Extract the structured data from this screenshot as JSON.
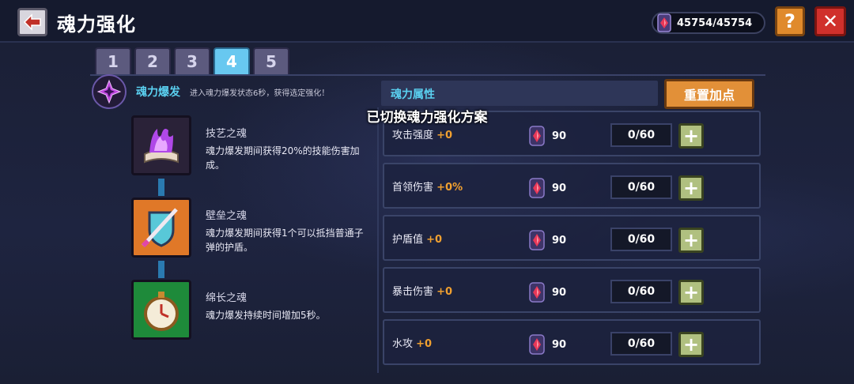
{
  "header": {
    "title": "魂力强化",
    "currency": "45754/45754",
    "help_label": "?",
    "close_label": "✕"
  },
  "tabs": [
    "1",
    "2",
    "3",
    "4",
    "5"
  ],
  "active_tab": "4",
  "burst": {
    "label": "魂力爆发",
    "desc": "进入魂力爆发状态6秒，获得选定强化！"
  },
  "souls": [
    {
      "name": "技艺之魂",
      "desc": "魂力爆发期间获得20%的技能伤害加成。",
      "icon": "purple-flame-book-icon"
    },
    {
      "name": "壁垒之魂",
      "desc": "魂力爆发期间获得1个可以抵挡普通子弹的护盾。",
      "icon": "shield-sword-icon"
    },
    {
      "name": "绵长之魂",
      "desc": "魂力爆发持续时间增加5秒。",
      "icon": "stopwatch-icon"
    }
  ],
  "attributes": {
    "header": "魂力属性",
    "reset_label": "重置加点",
    "rows": [
      {
        "name": "攻击强度",
        "bonus": "+0",
        "cost": "90",
        "level": "0/60"
      },
      {
        "name": "首领伤害",
        "bonus": "+0%",
        "cost": "90",
        "level": "0/60"
      },
      {
        "name": "护盾值",
        "bonus": "+0",
        "cost": "90",
        "level": "0/60"
      },
      {
        "name": "暴击伤害",
        "bonus": "+0",
        "cost": "90",
        "level": "0/60"
      },
      {
        "name": "水攻",
        "bonus": "+0",
        "cost": "90",
        "level": "0/60"
      }
    ]
  },
  "toast": "已切换魂力强化方案",
  "colors": {
    "accent": "#5ad0f0",
    "bonus": "#f0a030",
    "reset_button": "#e29038",
    "close_button": "#d0302c",
    "help_button": "#e08a2c"
  }
}
